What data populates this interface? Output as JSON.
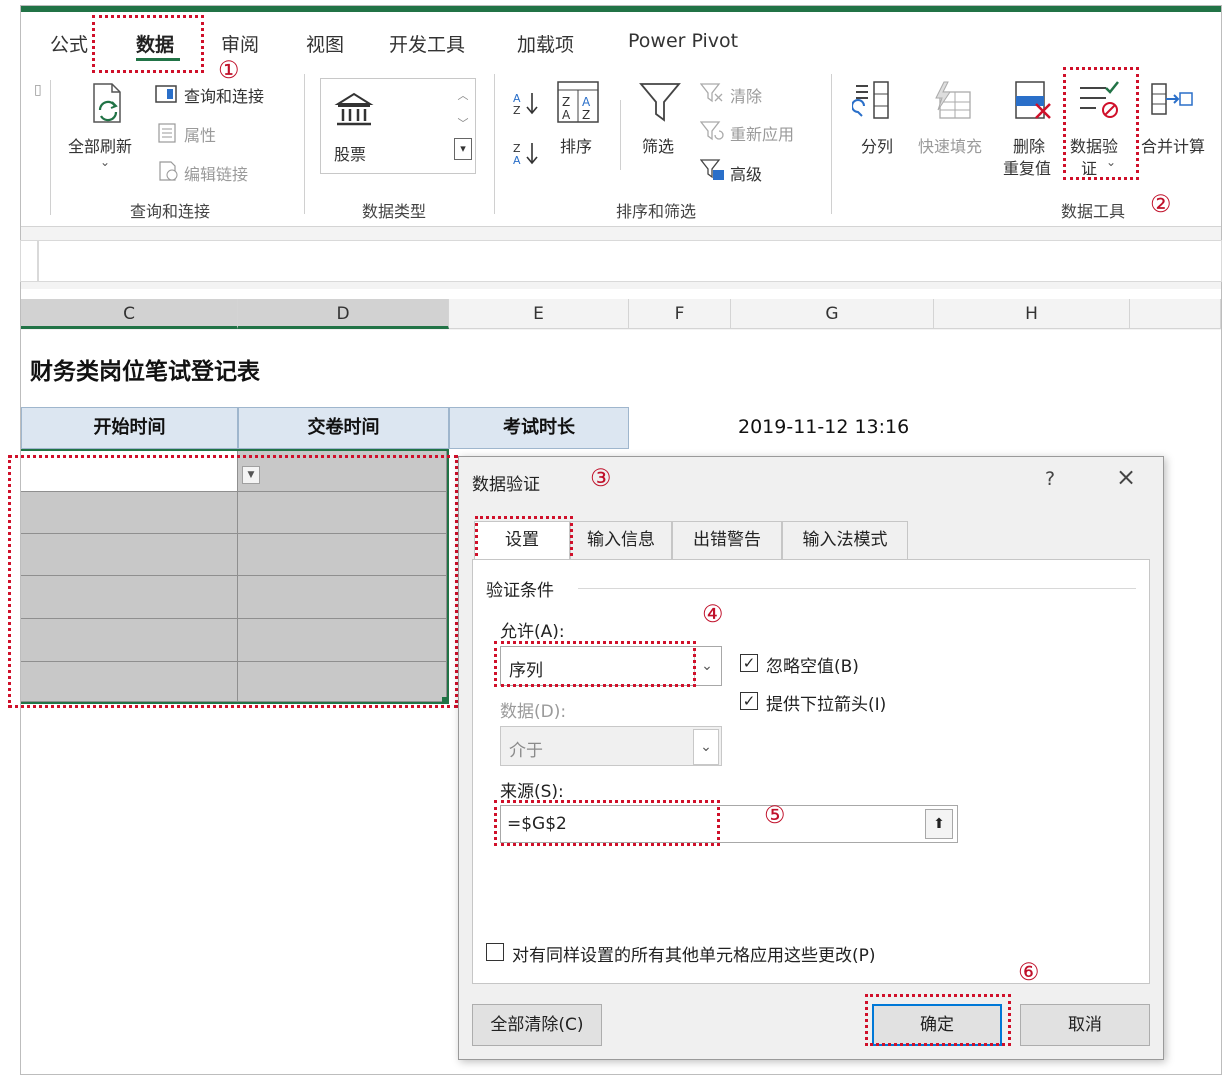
{
  "ribbon": {
    "tabs": [
      "公式",
      "数据",
      "审阅",
      "视图",
      "开发工具",
      "加载项",
      "Power Pivot"
    ],
    "active_tab": "数据",
    "groups": {
      "query": {
        "refresh_all": "全部刷新",
        "queries_connections": "查询和连接",
        "properties": "属性",
        "edit_links": "编辑链接",
        "label": "查询和连接"
      },
      "data_types": {
        "stocks": "股票",
        "label": "数据类型"
      },
      "sort_filter": {
        "sort": "排序",
        "filter": "筛选",
        "clear": "清除",
        "reapply": "重新应用",
        "advanced": "高级",
        "label": "排序和筛选"
      },
      "data_tools": {
        "text_to_columns": "分列",
        "flash_fill": "快速填充",
        "remove_dup_1": "删除",
        "remove_dup_2": "重复值",
        "validation_1": "数据验",
        "validation_2": "证",
        "consolidate": "合并计算",
        "label": "数据工具"
      }
    }
  },
  "sheet": {
    "columns": [
      "C",
      "D",
      "E",
      "F",
      "G",
      "H"
    ],
    "title": "财务类岗位笔试登记表",
    "headers": [
      "开始时间",
      "交卷时间",
      "考试时长"
    ],
    "timestamp": "2019-11-12 13:16"
  },
  "annotations": [
    "①",
    "②",
    "③",
    "④",
    "⑤",
    "⑥"
  ],
  "dialog": {
    "title": "数据验证",
    "help": "?",
    "close": "×",
    "tabs": [
      "设置",
      "输入信息",
      "出错警告",
      "输入法模式"
    ],
    "section": "验证条件",
    "allow_label": "允许(A):",
    "allow_value": "序列",
    "ignore_blank": "忽略空值(B)",
    "dropdown": "提供下拉箭头(I)",
    "data_label": "数据(D):",
    "data_value": "介于",
    "source_label": "来源(S):",
    "source_value": "=$G$2",
    "apply_all": "对有同样设置的所有其他单元格应用这些更改(P)",
    "clear_all": "全部清除(C)",
    "ok": "确定",
    "cancel": "取消"
  },
  "colors": {
    "excel_green": "#217346",
    "annotation_red": "#d0102a",
    "header_fill": "#dce6f1"
  }
}
